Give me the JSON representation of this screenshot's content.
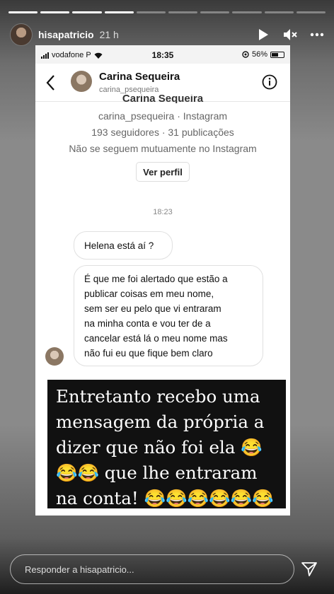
{
  "story": {
    "username": "hisapatricio",
    "time_ago": "21 h",
    "segments": [
      1,
      1,
      1,
      1,
      0,
      0,
      0,
      0,
      0,
      0
    ],
    "icons": [
      "play-icon",
      "mute-icon",
      "more-icon"
    ]
  },
  "phone": {
    "carrier": "vodafone P",
    "time": "18:35",
    "battery": "56%",
    "battery_level": 0.56
  },
  "chat": {
    "name": "Carina Sequeira",
    "handle": "carina_psequeira",
    "profile_name_cut": "Carina Sequeira",
    "profile_line1": "carina_psequeira · Instagram",
    "profile_line2": "193 seguidores · 31 publicações",
    "profile_line3": "Não se seguem mutuamente no Instagram",
    "view_profile": "Ver perfil",
    "timestamp": "18:23",
    "messages": [
      "Helena está aí ?",
      "É que me foi alertado que estão a\npublicar coisas em meu nome,\nsem ser eu pelo que vi entraram\nna minha conta e vou ter de a\ncancelar está lá o meu nome mas\nnão fui eu que fique bem claro"
    ]
  },
  "caption": {
    "lines": [
      "Entretanto recebo uma",
      "mensagem da própria a",
      "dizer que não foi ela 😂",
      "😂😂 que lhe entraram",
      "na conta! 😂😂😂😂😂😂"
    ]
  },
  "reply": {
    "placeholder": "Responder a hisapatricio..."
  }
}
